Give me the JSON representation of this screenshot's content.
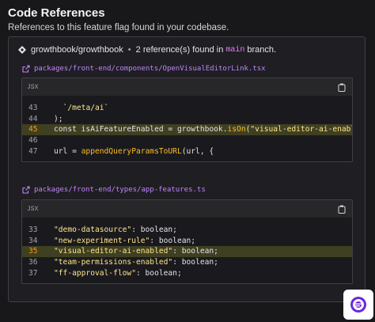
{
  "header": {
    "title": "Code References",
    "subtitle": "References to this feature flag found in your codebase."
  },
  "summary": {
    "repo": "growthbook/growthbook",
    "separator": "•",
    "count_text": "2 reference(s) found in",
    "branch": "main",
    "branch_suffix": "branch."
  },
  "references": [
    {
      "file": "packages/front-end/components/OpenVisualEditorLink.tsx",
      "language": "JSX",
      "lines": [
        {
          "num": "43",
          "indent": "  ",
          "tokens": [
            {
              "t": "`/meta/ai`",
              "c": "str"
            }
          ]
        },
        {
          "num": "44",
          "indent": "",
          "tokens": [
            {
              "t": ");",
              "c": "plain"
            }
          ]
        },
        {
          "num": "45",
          "indent": "",
          "highlight": true,
          "tokens": [
            {
              "t": "const isAiFeatureEnabled = growthbook.",
              "c": "plain"
            },
            {
              "t": "isOn",
              "c": "fn"
            },
            {
              "t": "(",
              "c": "plain"
            },
            {
              "t": "\"visual-editor-ai-enabled\"",
              "c": "str"
            },
            {
              "t": ");",
              "c": "plain"
            }
          ]
        },
        {
          "num": "46",
          "indent": "",
          "tokens": []
        },
        {
          "num": "47",
          "indent": "",
          "tokens": [
            {
              "t": "url = ",
              "c": "plain"
            },
            {
              "t": "appendQueryParamsToURL",
              "c": "fn"
            },
            {
              "t": "(url, {",
              "c": "plain"
            }
          ]
        }
      ]
    },
    {
      "file": "packages/front-end/types/app-features.ts",
      "language": "JSX",
      "lines": [
        {
          "num": "33",
          "indent": "",
          "tokens": [
            {
              "t": "\"demo-datasource\"",
              "c": "str"
            },
            {
              "t": ": boolean;",
              "c": "plain"
            }
          ]
        },
        {
          "num": "34",
          "indent": "",
          "tokens": [
            {
              "t": "\"new-experiment-rule\"",
              "c": "str"
            },
            {
              "t": ": boolean;",
              "c": "plain"
            }
          ]
        },
        {
          "num": "35",
          "indent": "",
          "highlight": true,
          "tokens": [
            {
              "t": "\"visual-editor-ai-enabled\"",
              "c": "str"
            },
            {
              "t": ": boolean;",
              "c": "plain"
            }
          ]
        },
        {
          "num": "36",
          "indent": "",
          "tokens": [
            {
              "t": "\"team-permissions-enabled\"",
              "c": "str"
            },
            {
              "t": ": boolean;",
              "c": "plain"
            }
          ]
        },
        {
          "num": "37",
          "indent": "",
          "tokens": [
            {
              "t": "\"ff-approval-flow\"",
              "c": "str"
            },
            {
              "t": ": boolean;",
              "c": "plain"
            }
          ]
        }
      ]
    }
  ],
  "icons": {
    "repo": "github-icon",
    "external": "external-link-icon",
    "copy": "copy-icon",
    "fab": "chat-widget-icon"
  },
  "colors": {
    "accent": "#c084fc",
    "highlight_bg": "#3f3f22",
    "string": "#fde68a"
  }
}
